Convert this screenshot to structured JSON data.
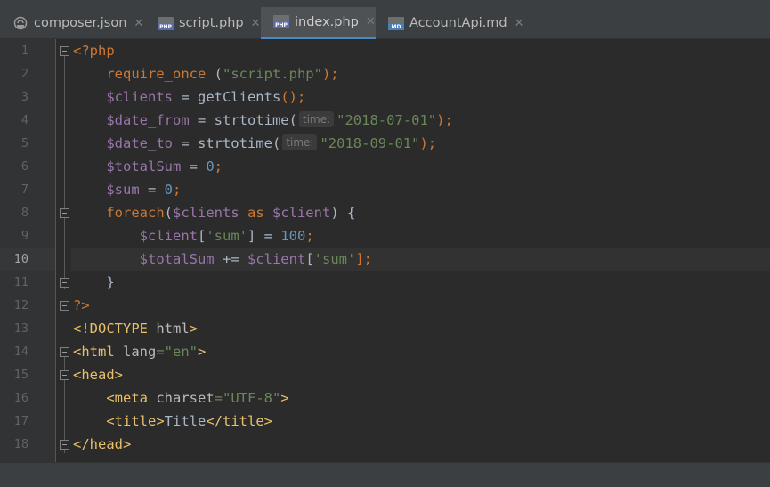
{
  "tabs": [
    {
      "label": "composer.json",
      "icon": "composer-file-icon"
    },
    {
      "label": "script.php",
      "icon": "php-file-icon",
      "badge": "PHP"
    },
    {
      "label": "index.php",
      "icon": "php-file-icon",
      "badge": "PHP",
      "active": true
    },
    {
      "label": "AccountApi.md",
      "icon": "markdown-file-icon",
      "badge": "MD"
    }
  ],
  "close_glyph": "✕",
  "line_numbers": [
    "1",
    "2",
    "3",
    "4",
    "5",
    "6",
    "7",
    "8",
    "9",
    "10",
    "11",
    "12",
    "13",
    "14",
    "15",
    "16",
    "17",
    "18"
  ],
  "current_line": "10",
  "code": {
    "l1": {
      "t1": "<?php"
    },
    "l2": {
      "t1": "require_once",
      "t2": " (",
      "t3": "\"script.php\"",
      "t4": ");"
    },
    "l3": {
      "t1": "$clients",
      "t2": " = ",
      "t3": "getClients",
      "t4": "();"
    },
    "l4": {
      "t1": "$date_from",
      "t2": " = strtotime(",
      "hint": "time:",
      "t3": "\"2018-07-01\"",
      "t4": ");"
    },
    "l5": {
      "t1": "$date_to",
      "t2": " = strtotime(",
      "hint": "time:",
      "t3": "\"2018-09-01\"",
      "t4": ");"
    },
    "l6": {
      "t1": "$totalSum",
      "t2": " = ",
      "t3": "0",
      "t4": ";"
    },
    "l7": {
      "t1": "$sum",
      "t2": " = ",
      "t3": "0",
      "t4": ";"
    },
    "l8": {
      "t1": "foreach",
      "t2": "(",
      "t3": "$clients",
      "t4": " as ",
      "t5": "$client",
      "t6": ") {"
    },
    "l9": {
      "t1": "$client",
      "t2": "[",
      "t3": "'sum'",
      "t4": "] = ",
      "t5": "100",
      "t6": ";"
    },
    "l10": {
      "t1": "$totalSum",
      "t2": " += ",
      "t3": "$client",
      "t4": "[",
      "t5": "'sum'",
      "t6": "];"
    },
    "l11": {
      "t1": "}"
    },
    "l12": {
      "t1": "?>"
    },
    "l13": {
      "t1": "<!DOCTYPE ",
      "t2": "html",
      "t3": ">"
    },
    "l14": {
      "t1": "<html ",
      "t2": "lang",
      "t3": "=",
      "t4": "\"en\"",
      "t5": ">"
    },
    "l15": {
      "t1": "<head>"
    },
    "l16": {
      "t1": "<meta ",
      "t2": "charset",
      "t3": "=",
      "t4": "\"UTF-8\"",
      "t5": ">"
    },
    "l17": {
      "t1": "<title>",
      "t2": "Title",
      "t3": "</title>"
    },
    "l18": {
      "t1": "</head>"
    }
  },
  "colors": {
    "background": "#2b2b2b",
    "keyword": "#cc7832",
    "string": "#6a8759",
    "variable": "#9876aa",
    "number": "#6897bb",
    "function": "#ffc66d",
    "tag": "#e8bf6a",
    "active_tab_underline": "#4a88c7"
  }
}
